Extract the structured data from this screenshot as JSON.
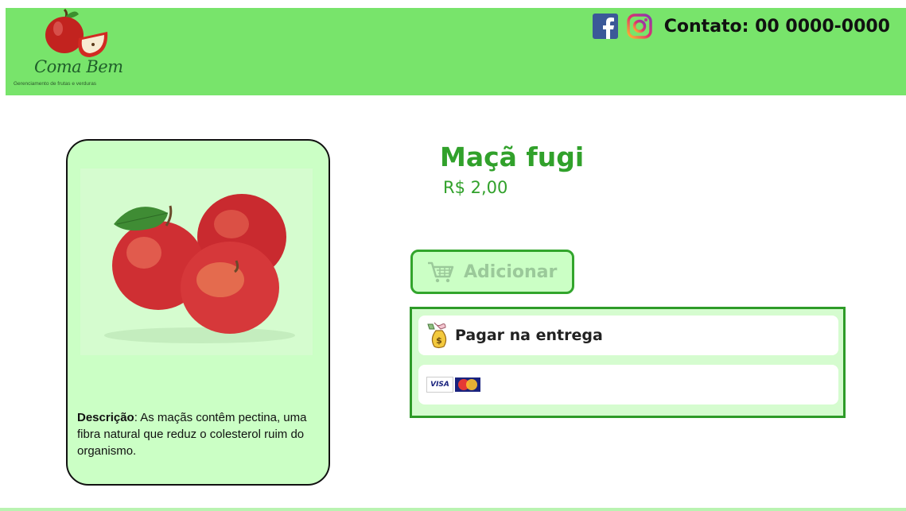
{
  "header": {
    "brand": "Coma Bem",
    "tagline": "Gerenciamento de frutas e verduras",
    "contact": "Contato: 00 0000-0000"
  },
  "product": {
    "name": "Maçã fugi",
    "price": "R$ 2,00",
    "description_label": "Descrição",
    "description_text": ": As maçãs contêm pectina, uma fibra natural que reduz o colesterol ruim do organismo."
  },
  "actions": {
    "add_label": "Adicionar"
  },
  "payment": {
    "on_delivery": "Pagar na entrega",
    "card_visa": "VISA"
  },
  "colors": {
    "header_bg": "#78e46b",
    "accent": "#31a12b",
    "card_bg": "#cbffc5"
  },
  "icons": [
    "apple-logo-icon",
    "facebook-icon",
    "instagram-icon",
    "cart-icon",
    "money-bag-icon",
    "visa-icon",
    "mastercard-icon"
  ]
}
